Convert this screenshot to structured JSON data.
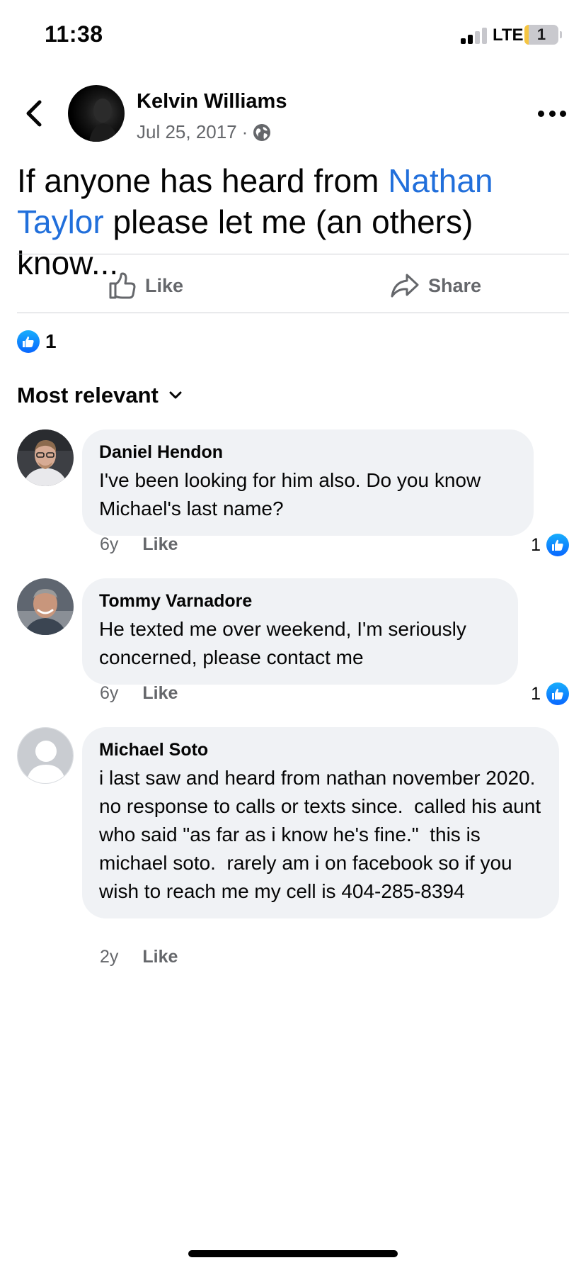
{
  "status_bar": {
    "time": "11:38",
    "network": "LTE",
    "battery_level": "1"
  },
  "post": {
    "author": "Kelvin Williams",
    "date": "Jul 25, 2017",
    "separator": "·",
    "visibility_icon": "globe-icon",
    "text_before": "If anyone has heard from ",
    "mention": "Nathan Taylor",
    "text_after": " please let me (an others) know..."
  },
  "actions": {
    "like_label": "Like",
    "share_label": "Share"
  },
  "reactions": {
    "count": "1"
  },
  "sort": {
    "label": "Most relevant"
  },
  "comments": [
    {
      "name": "Daniel Hendon",
      "text": "I've been looking for him also. Do you know Michael's last name?",
      "age": "6y",
      "like_label": "Like",
      "reaction_count": "1"
    },
    {
      "name": "Tommy Varnadore",
      "text": "He texted me over weekend, I'm seriously concerned, please contact me",
      "age": "6y",
      "like_label": "Like",
      "reaction_count": "1"
    },
    {
      "name": "Michael Soto",
      "text": "i last saw and heard from nathan november 2020.  no response to calls or texts since.  called his aunt who said \"as far as i know he's fine.\"  this is michael soto.  rarely am i on facebook so if you wish to reach me my cell is 404-285-8394",
      "age": "2y",
      "like_label": "Like"
    }
  ],
  "colors": {
    "link": "#216fdb",
    "secondary_text": "#65676b",
    "bubble": "#f0f2f5",
    "like_blue": "#0866ff"
  }
}
